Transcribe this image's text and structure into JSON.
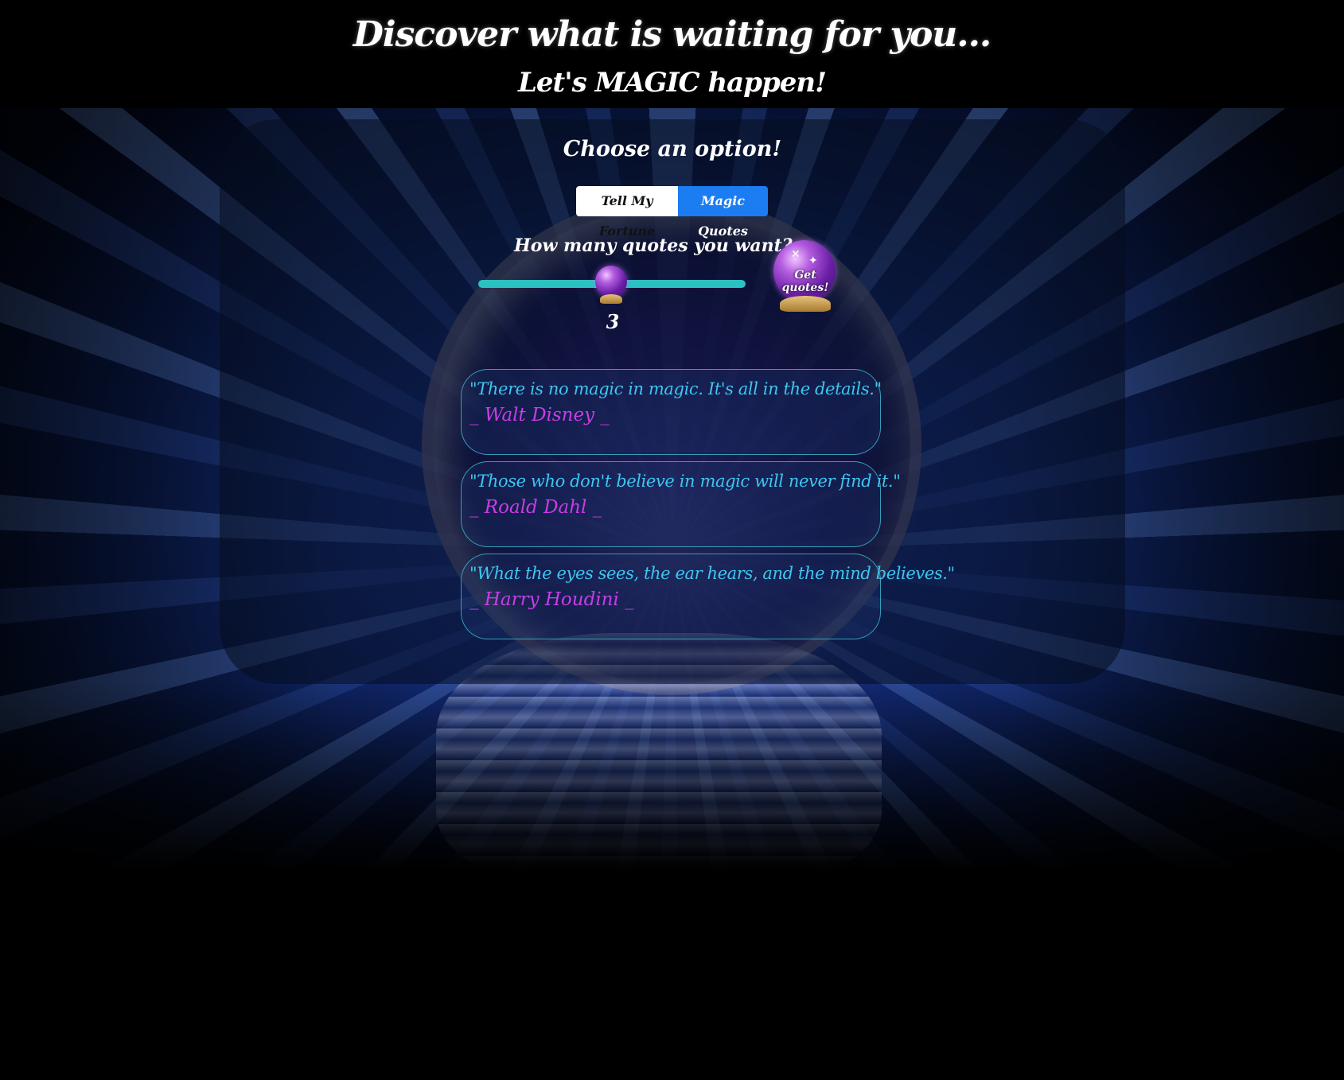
{
  "header": {
    "title": "Discover what is waiting for you...",
    "subtitle": "Let's MAGIC happen!"
  },
  "panel": {
    "prompt": "Choose an option!",
    "options": [
      {
        "label": "Tell My Fortune",
        "active": false
      },
      {
        "label": "Magic Quotes",
        "active": true
      }
    ],
    "quote_count_label": "How many quotes you want?",
    "quote_count_value": "3",
    "get_quotes_label": "Get quotes!"
  },
  "quotes": [
    {
      "text": "\"There is no magic in magic. It's all in the details.\"",
      "author": "_ Walt Disney _"
    },
    {
      "text": "\"Those who don't believe in magic will never find it.\"",
      "author": "_ Roald Dahl _"
    },
    {
      "text": "\"What the eyes sees, the ear hears, and the mind believes.\"",
      "author": "_ Harry Houdini _"
    }
  ],
  "colors": {
    "accent_blue": "#1c7cf2",
    "slider": "#2bc1c1",
    "quote_text": "#3dc6f0",
    "quote_author": "#c63ee6"
  },
  "icons": {
    "slider_thumb": "crystal-ball-icon",
    "get_quotes": "crystal-ball-icon"
  }
}
